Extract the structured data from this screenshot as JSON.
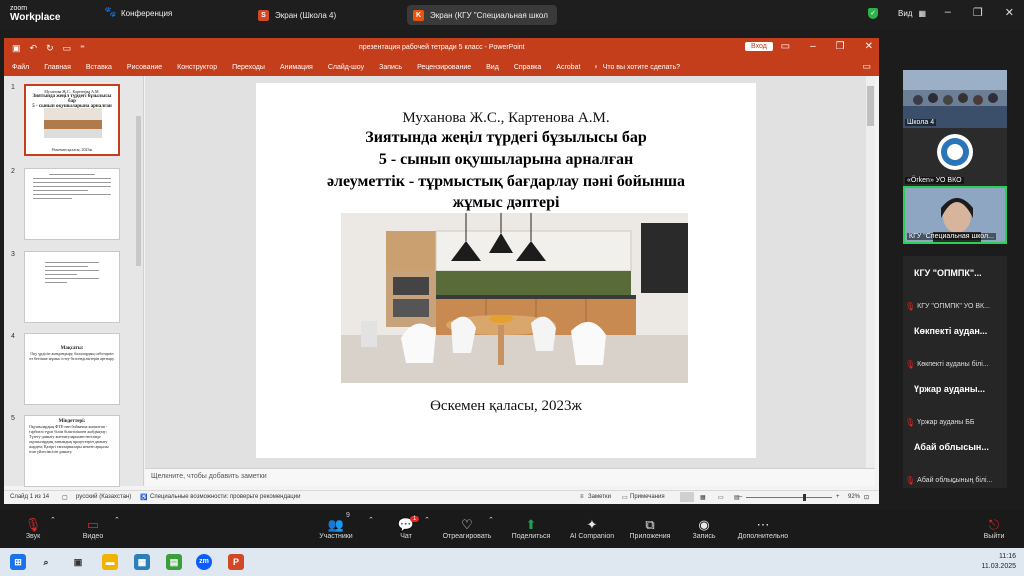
{
  "zoom": {
    "logo_line1": "zoom",
    "logo_line2": "Workplace",
    "conference_tab": "Конференция",
    "share_tabs": [
      {
        "label": "Экран (Школа 4)",
        "icon": "S"
      },
      {
        "label": "Экран (КГУ \"Специальная школ",
        "icon": "K"
      }
    ],
    "view_label": "Вид",
    "colors": {
      "accent_green": "#2ad152",
      "danger": "#e02828",
      "share_green": "#1ea353"
    }
  },
  "ppt": {
    "title": "презентация рабочей тетради 5 класс  -  PowerPoint",
    "sign_in": "Вход",
    "ribbon_tabs": [
      "Файл",
      "Главная",
      "Вставка",
      "Рисование",
      "Конструктор",
      "Переходы",
      "Анимация",
      "Слайд-шоу",
      "Запись",
      "Рецензирование",
      "Вид",
      "Справка",
      "Acrobat"
    ],
    "tell_me": "Что вы хотите сделать?",
    "accent": "#c43e1c",
    "thumbnails": [
      {
        "num": "1",
        "line1": "Муханова Ж.С., Картенова А.М.",
        "line2": "Зиятында жеңіл түрдегі бұзылысы бар",
        "line3": "5 - сынып оқушыларына арналған",
        "line4": "Өскемен қаласы, 2023ж"
      },
      {
        "num": "2"
      },
      {
        "num": "3"
      },
      {
        "num": "4",
        "heading": "Мақсаты:",
        "body": "Оқу үрдісін жандандыру, балалардың саботаргін өз бетінше жұмыс істеу белсенділіктерін арттыру."
      },
      {
        "num": "5",
        "heading": "Міндеттері:",
        "body": "Оқушылардың ФТЕ-нен бойынша жазылған - тәрбиелі түрлі білім біліктілікпен жабдықтау; Түзету-дамыту жаттығуларымен негізінде оқушылардың танымдық процестерін дамыту жәрдем; Қазіргі тапсырмалары мектеп арқылы өзін үйлесімсізін дамыту."
      }
    ],
    "slide": {
      "author": "Муханова Ж.С., Картенова А.М.",
      "lines": [
        "Зиятында жеңіл түрдегі бұзылысы бар",
        "5 - сынып оқушыларына арналған",
        "әлеуметтік - тұрмыстық бағдарлау пәні бойынша",
        "жұмыс дәптері"
      ],
      "city": "Өскемен қаласы, 2023ж"
    },
    "notes_placeholder": "Щелкните, чтобы добавить заметки",
    "status": {
      "slide_of": "Слайд 1 из 14",
      "language": "русский (Казахстан)",
      "accessibility": "Специальные возможности: проверьте рекомендации",
      "notes_btn": "Заметки",
      "comments_btn": "Примечания",
      "zoom": "92%"
    }
  },
  "participants": {
    "videos": [
      {
        "name": "Школа 4"
      },
      {
        "name": "«Örken» УО ВКО"
      },
      {
        "name": "КГУ \"Специальная школ..."
      }
    ],
    "tiles": [
      {
        "big": "КГУ  \"ОПМПК\"...",
        "small": "КГУ \"ОПМПК\" УО ВК..."
      },
      {
        "big": "Көкпекті аудан...",
        "small": "Көкпекті ауданы білі..."
      },
      {
        "big": "Үржар ауданы...",
        "small": "Үржар ауданы ББ"
      },
      {
        "big": "Абай облысын...",
        "small": "Абай облысының білі..."
      }
    ]
  },
  "toolbar": {
    "sound": "Звук",
    "video": "Видео",
    "participants": "Участники",
    "participants_count": "9",
    "chat": "Чат",
    "chat_badge": "1",
    "react": "Отреагировать",
    "share": "Поделиться",
    "ai": "AI Companion",
    "apps": "Приложения",
    "record": "Запись",
    "more": "Дополнительно",
    "leave": "Выйти"
  },
  "taskbar": {
    "time": "11:16",
    "date": "11.03.2025"
  }
}
